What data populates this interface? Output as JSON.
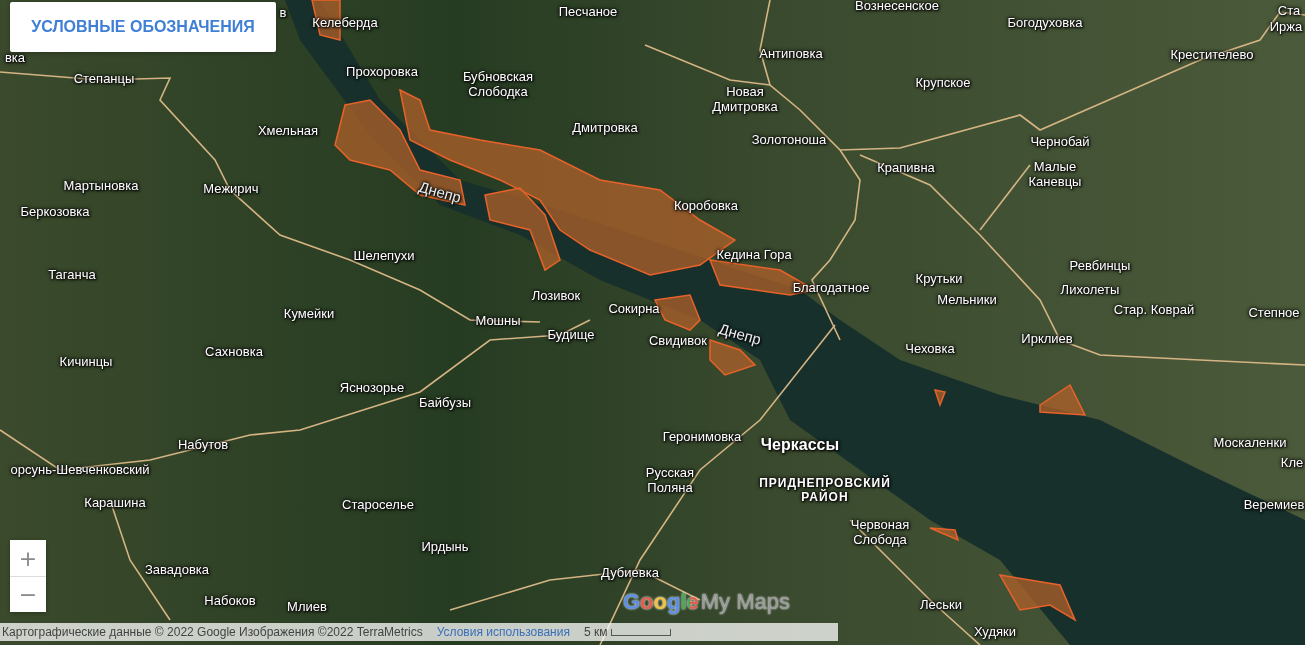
{
  "legend_button": {
    "label": "УСЛОВНЫЕ ОБОЗНАЧЕНИЯ"
  },
  "map": {
    "places": [
      {
        "name": "в",
        "kind": "town"
      },
      {
        "name": "Песчаное",
        "kind": "town"
      },
      {
        "name": "Вознесенское",
        "kind": "town"
      },
      {
        "name": "Ста",
        "kind": "town"
      },
      {
        "name": "Келеберда",
        "kind": "town"
      },
      {
        "name": "Богодуховка",
        "kind": "town"
      },
      {
        "name": "Иржа",
        "kind": "town"
      },
      {
        "name": "вка",
        "kind": "town"
      },
      {
        "name": "Антиповка",
        "kind": "town"
      },
      {
        "name": "Крестителево",
        "kind": "town"
      },
      {
        "name": "Степанцы",
        "kind": "town"
      },
      {
        "name": "Прохоровка",
        "kind": "town"
      },
      {
        "name": "Бубновская Слободка",
        "kind": "town_wrap"
      },
      {
        "name": "Новая Дмитровка",
        "kind": "town_wrap"
      },
      {
        "name": "Крупское",
        "kind": "town"
      },
      {
        "name": "Хмельная",
        "kind": "town"
      },
      {
        "name": "Дмитровка",
        "kind": "town"
      },
      {
        "name": "Золотоноша",
        "kind": "town"
      },
      {
        "name": "Чернобай",
        "kind": "town"
      },
      {
        "name": "Крапивна",
        "kind": "town"
      },
      {
        "name": "Мартыновка",
        "kind": "town"
      },
      {
        "name": "Межирич",
        "kind": "town"
      },
      {
        "name": "Днепр",
        "kind": "river"
      },
      {
        "name": "Малые Каневцы",
        "kind": "town_wrap"
      },
      {
        "name": "Беркозовка",
        "kind": "town"
      },
      {
        "name": "Коробовка",
        "kind": "town"
      },
      {
        "name": "Шелепухи",
        "kind": "town"
      },
      {
        "name": "Кедина Гора",
        "kind": "town"
      },
      {
        "name": "Таганча",
        "kind": "town"
      },
      {
        "name": "Ревбинцы",
        "kind": "town"
      },
      {
        "name": "Крутьки",
        "kind": "town"
      },
      {
        "name": "Лозивок",
        "kind": "town"
      },
      {
        "name": "Благодатное",
        "kind": "town"
      },
      {
        "name": "Мельники",
        "kind": "town"
      },
      {
        "name": "Лихолеты",
        "kind": "town"
      },
      {
        "name": "Кумейки",
        "kind": "town"
      },
      {
        "name": "Мошны",
        "kind": "town"
      },
      {
        "name": "Сокирна",
        "kind": "town"
      },
      {
        "name": "Стар. Коврай",
        "kind": "town"
      },
      {
        "name": "Степное",
        "kind": "town"
      },
      {
        "name": "Будище",
        "kind": "town"
      },
      {
        "name": "Свидивок",
        "kind": "town"
      },
      {
        "name": "Днепр",
        "kind": "river"
      },
      {
        "name": "Ирклиев",
        "kind": "town"
      },
      {
        "name": "Сахновка",
        "kind": "town"
      },
      {
        "name": "Чеховка",
        "kind": "town"
      },
      {
        "name": "Кичинцы",
        "kind": "town"
      },
      {
        "name": "Яснозорье",
        "kind": "town"
      },
      {
        "name": "Байбузы",
        "kind": "town"
      },
      {
        "name": "Набутов",
        "kind": "town"
      },
      {
        "name": "Геронимовка",
        "kind": "town"
      },
      {
        "name": "Черкассы",
        "kind": "city"
      },
      {
        "name": "Москаленки",
        "kind": "town"
      },
      {
        "name": "орсунь-Шевченковский",
        "kind": "town"
      },
      {
        "name": "Русская Поляна",
        "kind": "town_wrap"
      },
      {
        "name": "Карашина",
        "kind": "town"
      },
      {
        "name": "Староселье",
        "kind": "town"
      },
      {
        "name": "ПРИДНЕПРОВСКИЙ РАЙОН",
        "kind": "district"
      },
      {
        "name": "Кле",
        "kind": "town"
      },
      {
        "name": "Веремиев",
        "kind": "town"
      },
      {
        "name": "Ирдынь",
        "kind": "town"
      },
      {
        "name": "Червоная Слобода",
        "kind": "town_wrap"
      },
      {
        "name": "Завадовка",
        "kind": "town"
      },
      {
        "name": "Дубиевка",
        "kind": "town"
      },
      {
        "name": "Набоков",
        "kind": "town"
      },
      {
        "name": "Млиев",
        "kind": "town"
      },
      {
        "name": "Леськи",
        "kind": "town"
      },
      {
        "name": "Худяки",
        "kind": "town"
      }
    ]
  },
  "zoom_controls": [
    "+",
    "−"
  ],
  "logo": {
    "brand": "Google",
    "product": "My Maps"
  },
  "attribution": {
    "text": "Картографические данные © 2022 Google Изображения ©2022 TerraMetrics",
    "terms_link": "Условия использования",
    "scale": "5 км"
  }
}
